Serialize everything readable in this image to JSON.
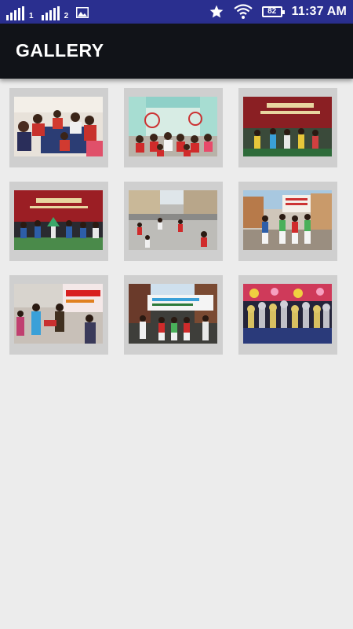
{
  "status_bar": {
    "sim1_label": "1",
    "sim2_label": "2",
    "battery": "82",
    "time": "11:37 AM",
    "icons": [
      "signal-sim1-icon",
      "signal-sim2-icon",
      "gallery-notification-icon",
      "star-icon",
      "wifi-icon",
      "battery-icon"
    ]
  },
  "app_bar": {
    "title": "GALLERY"
  },
  "gallery": {
    "items": [
      {
        "name": "gallery-photo-1",
        "description": "classroom children"
      },
      {
        "name": "gallery-photo-2",
        "description": "hall children celebration"
      },
      {
        "name": "gallery-photo-3",
        "description": "stage performance"
      },
      {
        "name": "gallery-photo-4",
        "description": "stage dance"
      },
      {
        "name": "gallery-photo-5",
        "description": "playground activity"
      },
      {
        "name": "gallery-photo-6",
        "description": "street rally"
      },
      {
        "name": "gallery-photo-7",
        "description": "prize ceremony"
      },
      {
        "name": "gallery-photo-8",
        "description": "banner rally"
      },
      {
        "name": "gallery-photo-9",
        "description": "trophies display"
      }
    ]
  }
}
